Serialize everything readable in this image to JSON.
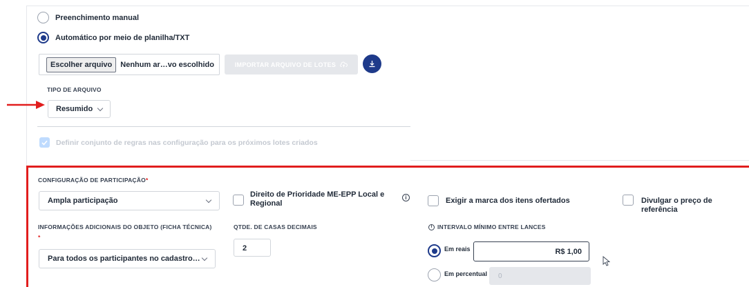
{
  "entry_mode": {
    "manual_label": "Preenchimento manual",
    "auto_label": "Automático por meio de planilha/TXT",
    "selected": "auto"
  },
  "file_upload": {
    "choose_label": "Escolher arquivo",
    "file_name": "Nenhum ar…vo escolhido",
    "import_label": "IMPORTAR ARQUIVO DE LOTES",
    "download_icon": "download-icon"
  },
  "file_type": {
    "label": "TIPO DE ARQUIVO",
    "value": "Resumido"
  },
  "rules_checkbox": {
    "label": "Definir conjunto de regras nas configuração para os próximos lotes criados",
    "checked": true,
    "disabled": true
  },
  "participation": {
    "label": "CONFIGURAÇÃO DE PARTICIPAÇÃO",
    "required_mark": "*",
    "value": "Ampla participação"
  },
  "priority_checkbox": {
    "label": "Direito de Prioridade ME-EPP Local e Regional",
    "info_icon": "info-icon"
  },
  "brand_checkbox": {
    "label": "Exigir a marca dos itens ofertados"
  },
  "price_checkbox": {
    "label": "Divulgar o preço de referência"
  },
  "additional_info": {
    "label": "INFORMAÇÕES ADICIONAIS DO OBJETO (FICHA TÉCNICA)",
    "required_mark": "*",
    "value": "Para todos os participantes no cadastro…"
  },
  "decimals": {
    "label": "QTDE. DE CASAS DECIMAIS",
    "value": "2"
  },
  "min_interval": {
    "label": "INTERVALO MÍNIMO ENTRE LANCES",
    "reais_label": "Em reais",
    "reais_value": "R$ 1,00",
    "percent_label": "Em percentual",
    "percent_placeholder": "0",
    "selected": "reais"
  },
  "colors": {
    "primary": "#1e3a8a",
    "highlight": "#e11d1d",
    "border": "#d1d5db"
  }
}
